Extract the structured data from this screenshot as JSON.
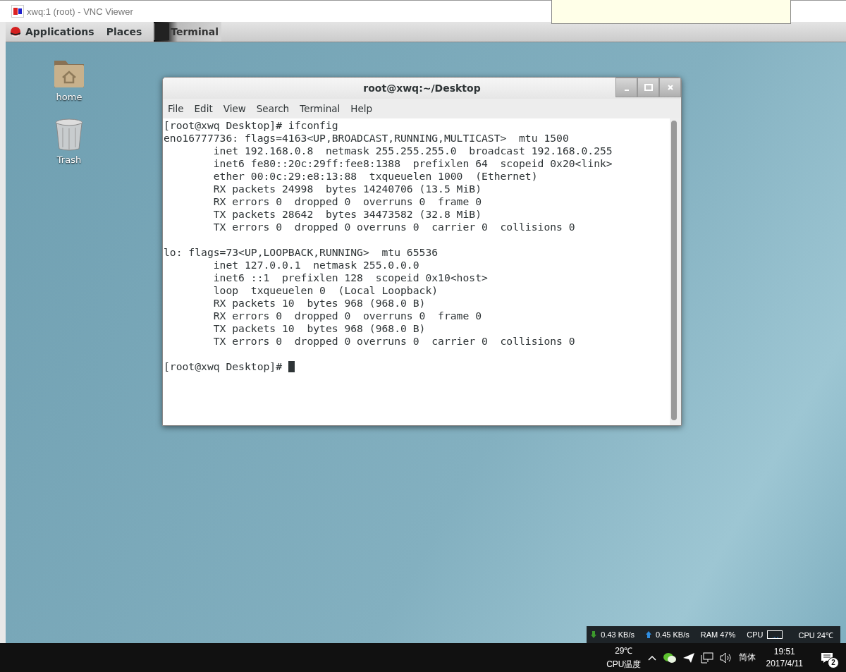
{
  "viewer_window": {
    "title": "xwq:1 (root) - VNC Viewer"
  },
  "top_bar": {
    "menus": [
      "Applications",
      "Places"
    ],
    "task": {
      "label": "Terminal"
    }
  },
  "desktop_icons": [
    {
      "kind": "folder",
      "label": "home"
    },
    {
      "kind": "trash",
      "label": "Trash"
    }
  ],
  "terminal": {
    "title": "root@xwq:~/Desktop",
    "menu": [
      "File",
      "Edit",
      "View",
      "Search",
      "Terminal",
      "Help"
    ],
    "sections": [
      [
        "[root@xwq Desktop]# ifconfig",
        "eno16777736: flags=4163<UP,BROADCAST,RUNNING,MULTICAST>  mtu 1500",
        "        inet 192.168.0.8  netmask 255.255.255.0  broadcast 192.168.0.255",
        "        inet6 fe80::20c:29ff:fee8:1388  prefixlen 64  scopeid 0x20<link>",
        "        ether 00:0c:29:e8:13:88  txqueuelen 1000  (Ethernet)",
        "        RX packets 24998  bytes 14240706 (13.5 MiB)",
        "        RX errors 0  dropped 0  overruns 0  frame 0",
        "        TX packets 28642  bytes 34473582 (32.8 MiB)",
        "        TX errors 0  dropped 0 overruns 0  carrier 0  collisions 0"
      ],
      [
        "lo: flags=73<UP,LOOPBACK,RUNNING>  mtu 65536",
        "        inet 127.0.0.1  netmask 255.0.0.0",
        "        inet6 ::1  prefixlen 128  scopeid 0x10<host>",
        "        loop  txqueuelen 0  (Local Loopback)",
        "        RX packets 10  bytes 968 (968.0 B)",
        "        RX errors 0  dropped 0  overruns 0  frame 0",
        "        TX packets 10  bytes 968 (968.0 B)",
        "        TX errors 0  dropped 0 overruns 0  carrier 0  collisions 0"
      ]
    ],
    "prompt": "[root@xwq Desktop]# "
  },
  "net_meter": {
    "download": "0.43 KB/s",
    "upload": "0.45 KB/s",
    "ram": "RAM 47%",
    "cpu_label": "CPU",
    "cpu_temp": "CPU 24℃"
  },
  "taskbar": {
    "temp": "29℃",
    "temp_label": "CPU温度",
    "ime": "简体",
    "time": "19:51",
    "date": "2017/4/11",
    "notifications": "2"
  }
}
